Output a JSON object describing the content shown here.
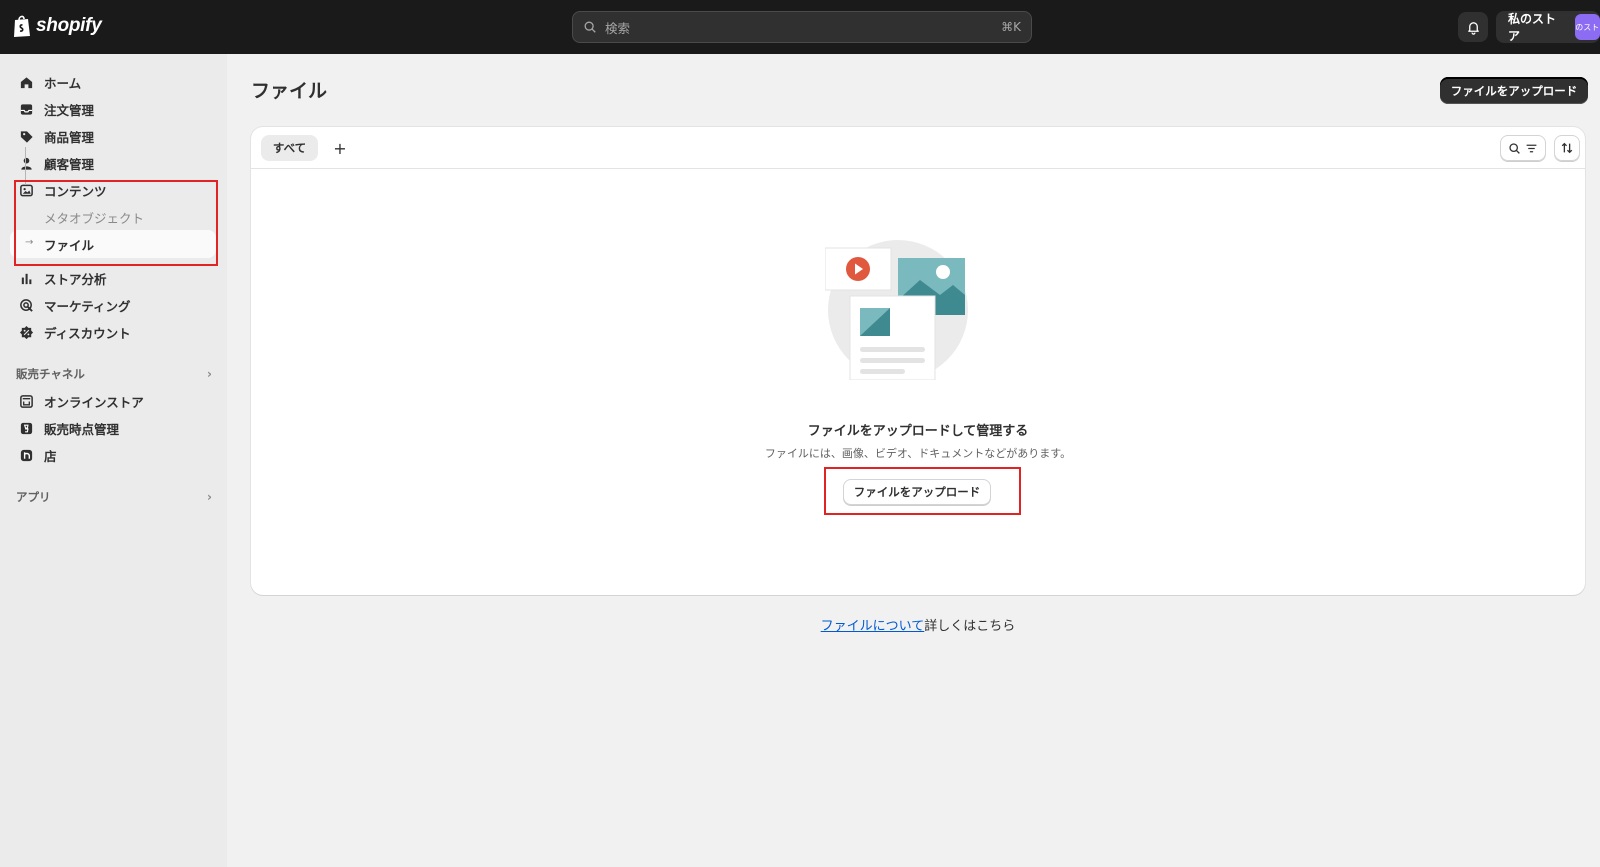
{
  "topbar": {
    "logo_text": "shopify",
    "search_placeholder": "検索",
    "search_shortcut": "⌘K",
    "store_name": "私のストア",
    "avatar_text": "のスト"
  },
  "sidebar": {
    "items": [
      {
        "label": "ホーム",
        "icon": "home-icon"
      },
      {
        "label": "注文管理",
        "icon": "inbox-icon"
      },
      {
        "label": "商品管理",
        "icon": "tag-icon"
      },
      {
        "label": "顧客管理",
        "icon": "person-icon"
      },
      {
        "label": "コンテンツ",
        "icon": "content-icon"
      },
      {
        "label": "ストア分析",
        "icon": "bar-chart-icon"
      },
      {
        "label": "マーケティング",
        "icon": "target-icon"
      },
      {
        "label": "ディスカウント",
        "icon": "discount-icon"
      }
    ],
    "sub_items": [
      {
        "label": "メタオブジェクト"
      },
      {
        "label": "ファイル"
      }
    ],
    "sales_channels_header": "販売チャネル",
    "sales_channels": [
      {
        "label": "オンラインストア",
        "icon": "store-icon"
      },
      {
        "label": "販売時点管理",
        "icon": "pos-icon"
      },
      {
        "label": "店",
        "icon": "shop-app-icon"
      }
    ],
    "apps_header": "アプリ"
  },
  "main": {
    "page_title": "ファイル",
    "upload_button": "ファイルをアップロード",
    "tab_all": "すべて",
    "tab_add": "+",
    "empty_state": {
      "title": "ファイルをアップロードして管理する",
      "description": "ファイルには、画像、ビデオ、ドキュメントなどがあります。",
      "button": "ファイルをアップロード"
    },
    "help": {
      "link_text": "ファイルについて",
      "suffix": "詳しくはこちら"
    }
  },
  "colors": {
    "topbar_bg": "#1a1a1a",
    "sidebar_bg": "#ebebeb",
    "page_bg": "#f1f1f1",
    "highlight_red": "#e02424",
    "link_blue": "#005bd3"
  }
}
